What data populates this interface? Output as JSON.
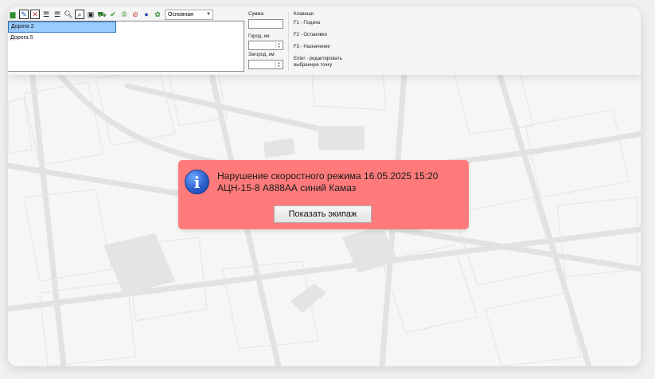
{
  "toolbar": {
    "icons": [
      "chart-icon",
      "edit-doc-icon",
      "delete-doc-icon",
      "list-add-icon",
      "list-insert-icon",
      "zoom-icon",
      "search-doc-icon",
      "save-icon",
      "vehicle-icon",
      "check-icon",
      "number-5-icon",
      "stop-icon",
      "globe-icon",
      "network-icon"
    ],
    "route_select": "Основная"
  },
  "routes": [
    "Дорога 2",
    "Дорога 5"
  ],
  "fields": {
    "sum_label": "Сумма:",
    "city_label": "Город, км:",
    "suburb_label": "Загород, км:"
  },
  "keys": {
    "title": "Клавиши",
    "f1": "F1 - Подача",
    "f2": "F2 - Остановки",
    "f3": "F3 - Назначение",
    "enter_line1": "Enter - редактировать",
    "enter_line2": "выбранную точку"
  },
  "notification": {
    "line1": "Нарушение скоростного режима 16.05.2025 15:20",
    "line2": "АЦН-15-8 А888АА синий Камаз",
    "button": "Показать экипаж",
    "icon": "info-icon",
    "background": "#ff7b7b"
  }
}
